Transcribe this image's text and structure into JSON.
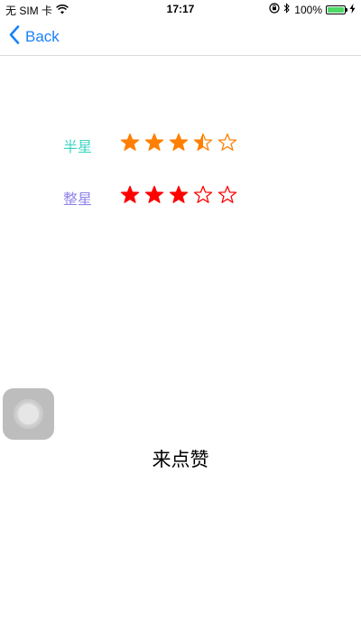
{
  "status_bar": {
    "carrier": "无 SIM 卡",
    "time": "17:17",
    "battery_percent": "100%",
    "battery_level": 1.0,
    "icons": [
      "wifi-icon",
      "orientation-lock-icon",
      "bluetooth-icon",
      "charging-icon"
    ]
  },
  "nav": {
    "back_label": "Back",
    "accent_color": "#1a82fb"
  },
  "ratings": [
    {
      "label": "半星",
      "label_color": "#3fd6c4",
      "star_color": "#ff7f00",
      "max": 5,
      "value": 3.5,
      "stars": [
        "full",
        "full",
        "full",
        "half",
        "empty"
      ]
    },
    {
      "label": "整星",
      "label_color": "#8e84e8",
      "star_color": "#ff0000",
      "max": 5,
      "value": 3,
      "stars": [
        "full",
        "full",
        "full",
        "empty",
        "empty"
      ]
    }
  ],
  "assistive_touch": {
    "icon": "assistive-touch-icon"
  },
  "like_label": "来点赞"
}
